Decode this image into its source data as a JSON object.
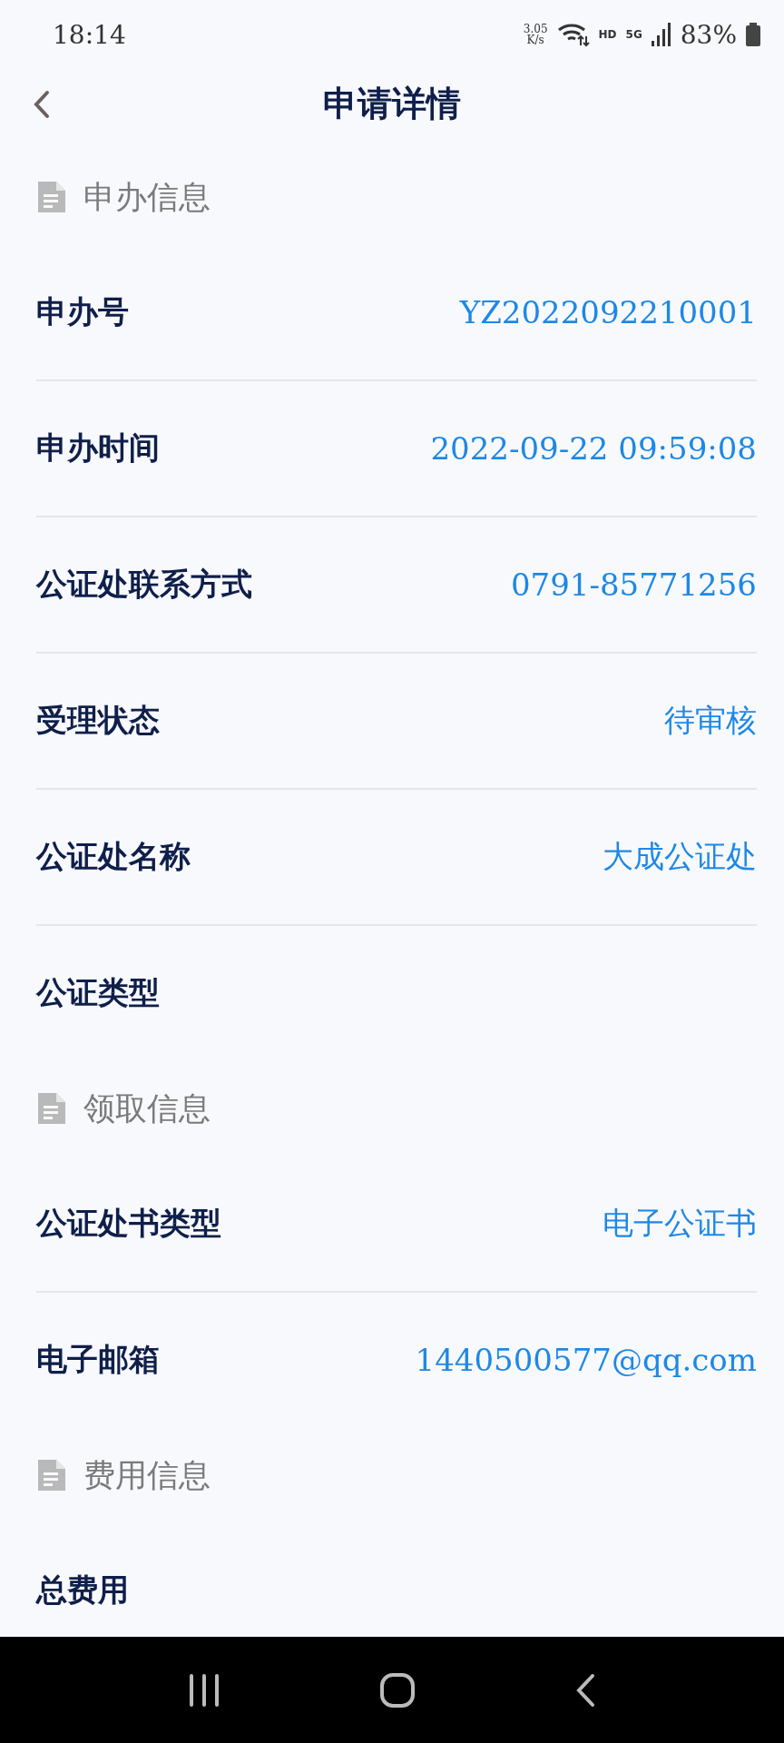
{
  "status_bar": {
    "time": "18:14",
    "speed_value": "3.05",
    "speed_unit": "K/s",
    "hd": "HD",
    "network": "5G",
    "battery": "83%"
  },
  "header": {
    "title": "申请详情"
  },
  "sections": [
    {
      "title": "申办信息",
      "rows": [
        {
          "label": "申办号",
          "value": "YZ2022092210001"
        },
        {
          "label": "申办时间",
          "value": "2022-09-22 09:59:08"
        },
        {
          "label": "公证处联系方式",
          "value": "0791-85771256"
        },
        {
          "label": "受理状态",
          "value": "待审核"
        },
        {
          "label": "公证处名称",
          "value": "大成公证处"
        },
        {
          "label": "公证类型"
        }
      ]
    },
    {
      "title": "领取信息",
      "rows": [
        {
          "label": "公证处书类型",
          "value": "电子公证书"
        },
        {
          "label": "电子邮箱",
          "value": "1440500577@qq.com"
        }
      ]
    },
    {
      "title": "费用信息",
      "rows": [
        {
          "label": "总费用"
        }
      ]
    }
  ]
}
